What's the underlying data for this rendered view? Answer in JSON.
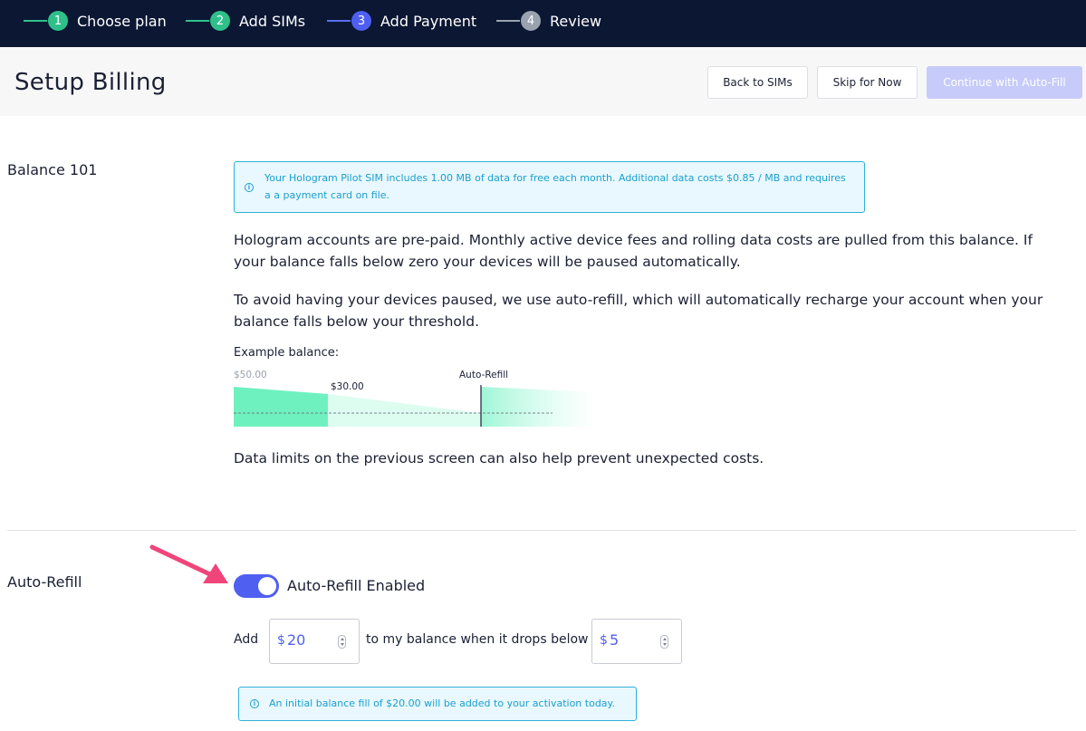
{
  "stepper": {
    "steps": [
      {
        "number": "1",
        "label": "Choose plan",
        "state": "done"
      },
      {
        "number": "2",
        "label": "Add SIMs",
        "state": "done"
      },
      {
        "number": "3",
        "label": "Add Payment",
        "state": "active"
      },
      {
        "number": "4",
        "label": "Review",
        "state": "todo"
      }
    ]
  },
  "header": {
    "title": "Setup Billing",
    "back_label": "Back to SIMs",
    "skip_label": "Skip for Now",
    "continue_label": "Continue with Auto-Fill"
  },
  "balance": {
    "section_label": "Balance 101",
    "info_text": "Your Hologram Pilot SIM includes 1.00 MB of data for free each month. Additional data costs $0.85 / MB and requires a a payment card on file.",
    "para1": "Hologram accounts are pre-paid. Monthly active device fees and rolling data costs are pulled from this balance. If your balance falls below zero your devices will be paused automatically.",
    "para2": "To avoid having your devices paused, we use auto-refill, which will automatically recharge your account when your balance falls below your threshold.",
    "example_label": "Example balance:",
    "example": {
      "start_label": "$50.00",
      "mid_label": "$30.00",
      "refill_label": "Auto-Refill"
    },
    "para3": "Data limits on the previous screen can also help prevent unexpected costs."
  },
  "auto_refill": {
    "section_label": "Auto-Refill",
    "toggle_label": "Auto-Refill Enabled",
    "toggle_on": true,
    "add_label": "Add",
    "currency": "$",
    "amount": "20",
    "middle_label": "to my balance when it drops below",
    "threshold": "5",
    "info_text": "An initial balance fill of $20.00 will be added to your activation today."
  },
  "colors": {
    "nav_bg": "#0b1733",
    "done": "#2fc08a",
    "active": "#4f5ff0",
    "info": "#1a9fcf",
    "arrow": "#f0457a"
  }
}
